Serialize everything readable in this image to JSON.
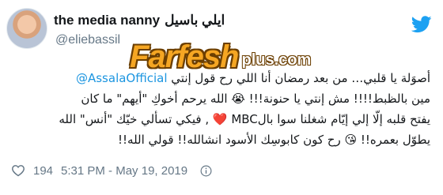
{
  "user": {
    "display_name_ar": "ايلي باسيل",
    "display_name_en": "the media nanny",
    "handle": "@eliebassil"
  },
  "watermark": {
    "main": "Farfesh",
    "sub": "plus.com"
  },
  "tweet": {
    "lines": [
      {
        "mention": "@AssalaOfficial",
        "text": " أصوَلة يا قلبي… من بعد رمضان أنا اللي رح قول إنتي"
      },
      {
        "text": "مين بالظبط!!!! مش إنتي يا حنونة!!! 😭 الله يرحم أخوكِ \"أيهم\" ما كان"
      },
      {
        "text": "يفتح قلبه إلّا إلي إيّام شغلنا سوا بالMBC ❤️ , فيكي تسألي خيّك \"أنس\" الله"
      },
      {
        "text": "يطوّل بعمره!! 😘 رح كون كابوسِك الأسود انشالله!! قولي الله!!"
      }
    ]
  },
  "footer": {
    "likes": "194",
    "timestamp": "5:31 PM - May 19, 2019"
  },
  "icons": {
    "brand": "twitter-bird-icon",
    "like": "heart-icon",
    "info": "info-icon"
  },
  "colors": {
    "link": "#1b95e0",
    "twitter_blue": "#1da1f2",
    "muted": "#657786",
    "watermark": "#f5a623"
  }
}
